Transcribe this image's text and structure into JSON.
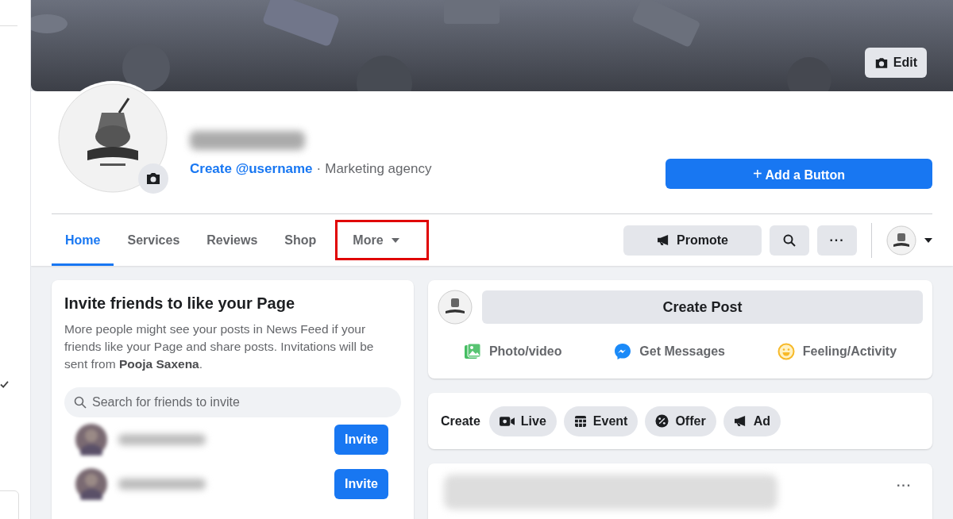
{
  "cover": {
    "edit_button": "Edit"
  },
  "profile": {
    "username_link": "Create @username",
    "separator": "·",
    "category": "Marketing agency",
    "add_button": "Add a Button",
    "add_icon": "+"
  },
  "tabs": [
    {
      "label": "Home",
      "selected": true,
      "highlighted": false,
      "dropdown": false
    },
    {
      "label": "Services",
      "selected": false,
      "highlighted": false,
      "dropdown": false
    },
    {
      "label": "Reviews",
      "selected": false,
      "highlighted": false,
      "dropdown": false
    },
    {
      "label": "Shop",
      "selected": false,
      "highlighted": false,
      "dropdown": false
    },
    {
      "label": "More",
      "selected": false,
      "highlighted": true,
      "dropdown": true
    }
  ],
  "actions": {
    "promote": "Promote",
    "more": "···"
  },
  "invite_card": {
    "title": "Invite friends to like your Page",
    "text": "More people might see your posts in News Feed if your friends like your Page and share posts. Invitations will be sent from **Pooja Saxena**.",
    "search": {
      "placeholder": "Search for friends to invite"
    },
    "friends": [
      {
        "button": "Invite"
      },
      {
        "button": "Invite"
      }
    ]
  },
  "composer": {
    "button": "Create Post",
    "options": [
      {
        "label": "Photo/video"
      },
      {
        "kind": "messages",
        "label": "Get Messages"
      },
      {
        "kind": "feeling",
        "label": "Feeling/Activity"
      }
    ]
  },
  "create_bar": {
    "label": "Create",
    "chips": [
      {
        "kind": "live",
        "label": "Live"
      },
      {
        "kind": "event",
        "label": "Event"
      },
      {
        "kind": "offer",
        "label": "Offer"
      },
      {
        "kind": "ad",
        "label": "Ad"
      }
    ]
  },
  "post": {
    "menu": "···"
  }
}
